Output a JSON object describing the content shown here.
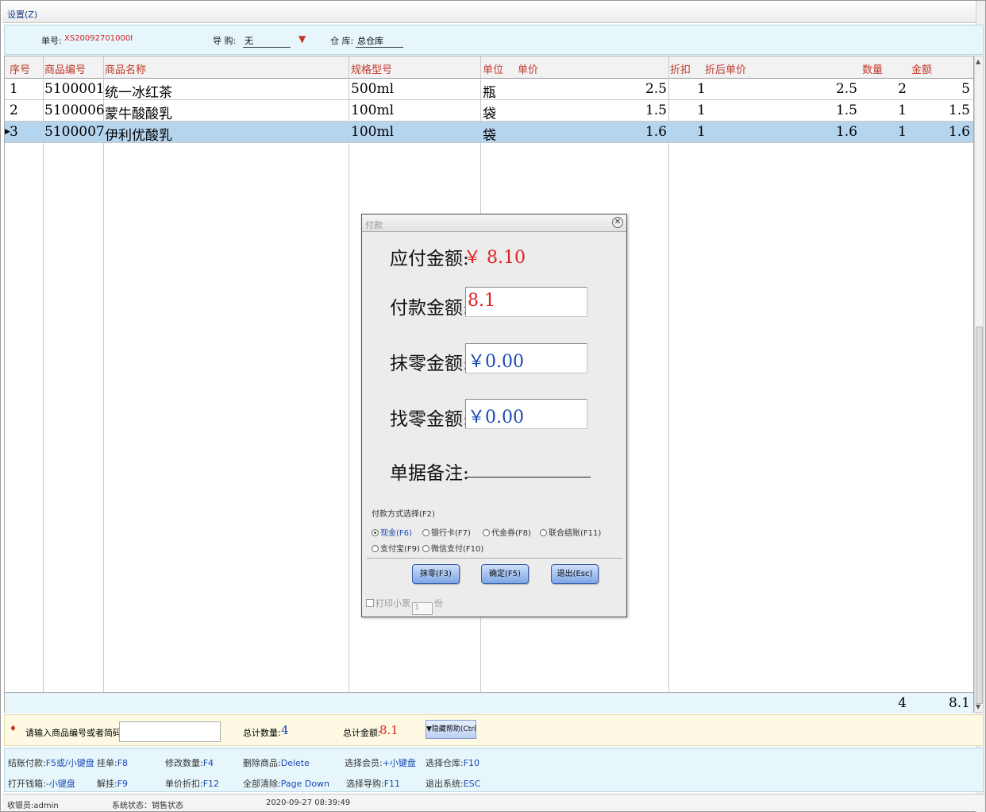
{
  "menu": {
    "settings": "设置(Z)"
  },
  "info": {
    "bill_no_label": "单号:",
    "bill_no_value": "XS20092701000I",
    "clerk_label": "导  购:",
    "clerk_value": "无",
    "warehouse_label": "仓  库:",
    "warehouse_value": "总仓库"
  },
  "grid": {
    "headers": {
      "seq": "序号",
      "code": "商品编号",
      "name": "商品名称",
      "spec": "规格型号",
      "unit": "单位",
      "price": "单价",
      "discount": "折扣",
      "disc_price": "折后单价",
      "qty": "数量",
      "amount": "金额"
    },
    "rows": [
      {
        "seq": "1",
        "code": "5100001",
        "name": "统一冰红茶",
        "spec": "500ml",
        "unit": "瓶",
        "price": "2.5",
        "discount": "1",
        "disc_price": "2.5",
        "qty": "2",
        "amount": "5"
      },
      {
        "seq": "2",
        "code": "5100006",
        "name": "蒙牛酸酸乳",
        "spec": "100ml",
        "unit": "袋",
        "price": "1.5",
        "discount": "1",
        "disc_price": "1.5",
        "qty": "1",
        "amount": "1.5"
      },
      {
        "seq": "3",
        "code": "5100007",
        "name": "伊利优酸乳",
        "spec": "100ml",
        "unit": "袋",
        "price": "1.6",
        "discount": "1",
        "disc_price": "1.6",
        "qty": "1",
        "amount": "1.6"
      }
    ],
    "selected_row": 3,
    "footer": {
      "qty": "4",
      "amount": "8.1"
    }
  },
  "entry": {
    "prompt": "请输入商品编号或者简码:",
    "input_value": "",
    "total_qty_label": "总计数量:",
    "total_qty": "4",
    "total_amount_label": "总计金额:",
    "total_amount": "8.1",
    "help_button": "▼隐藏帮助(Ctrl)"
  },
  "shortcuts": {
    "row1": [
      {
        "label": "结账付款:",
        "key": "F5或/小键盘"
      },
      {
        "label": "挂单:",
        "key": "F8"
      },
      {
        "label": "修改数量:",
        "key": "F4"
      },
      {
        "label": "删除商品:",
        "key": "Delete"
      },
      {
        "label": "选择会员:",
        "key": "+小键盘"
      },
      {
        "label": "选择仓库:",
        "key": "F10"
      }
    ],
    "row2": [
      {
        "label": "打开钱箱:",
        "key": "-小键盘"
      },
      {
        "label": "解挂:",
        "key": "F9"
      },
      {
        "label": "单价折扣:",
        "key": "F12"
      },
      {
        "label": "全部清除:",
        "key": "Page Down"
      },
      {
        "label": "选择导购:",
        "key": "F11"
      },
      {
        "label": "退出系统:",
        "key": "ESC"
      }
    ]
  },
  "status": {
    "cashier": "收银员:admin",
    "system_state": "系统状态：销售状态",
    "datetime": "2020-09-27 08:39:49"
  },
  "dialog": {
    "title": "付款",
    "due_label": "应付金额:",
    "due_value": "￥ 8.10",
    "paid_label": "付款金额:",
    "paid_value": "8.1",
    "rounding_label": "抹零金额:",
    "rounding_value": "￥0.00",
    "change_label": "找零金额:",
    "change_value": "￥0.00",
    "remark_label": "单据备注:",
    "payment_method_title": "付款方式选择(F2)",
    "methods": [
      {
        "label": "现金(F6)",
        "checked": true
      },
      {
        "label": "银行卡(F7)",
        "checked": false
      },
      {
        "label": "代金券(F8)",
        "checked": false
      },
      {
        "label": "联合结账(F11)",
        "checked": false
      },
      {
        "label": "支付宝(F9)",
        "checked": false
      },
      {
        "label": "微信支付(F10)",
        "checked": false
      }
    ],
    "buttons": {
      "rounding": "抹零(F3)",
      "confirm": "确定(F5)",
      "exit": "退出(Esc)"
    },
    "print_label": "打印小票",
    "print_copies": "1",
    "print_unit": "份"
  },
  "colors": {
    "accent_red": "#e02020",
    "accent_blue": "#1a49b5",
    "selected_row": "#b5d4ee",
    "info_bg": "#e6f6fb"
  }
}
